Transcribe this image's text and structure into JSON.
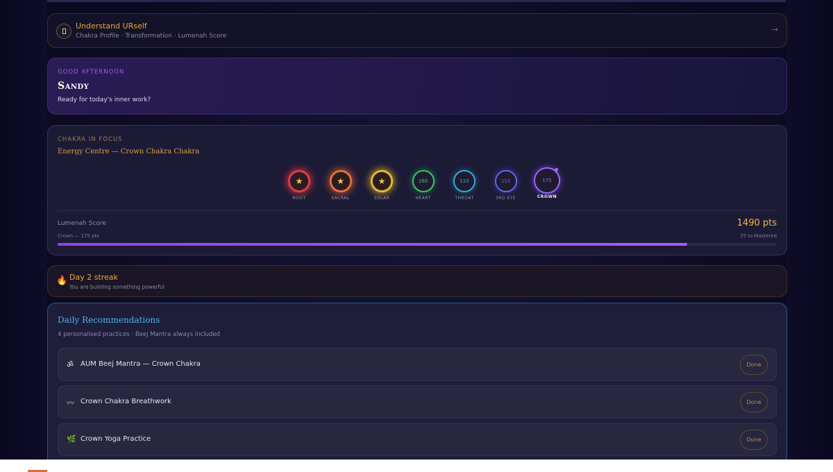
{
  "understand": {
    "title": "Understand URself",
    "subtitle": "Chakra Profile · Transformation · Lumenah Score",
    "arrow": "→"
  },
  "greeting": {
    "label": "GOOD AFTERNOON",
    "name": "Sandy",
    "subtitle": "Ready for today's inner work?"
  },
  "chakra": {
    "label": "CHAKRA IN FOCUS",
    "subtitle": "Energy Centre — Crown Chakra Chakra",
    "items": [
      {
        "name": "ROOT",
        "value": "★",
        "color": "#e0424f",
        "glow": "#c0303f",
        "mastered": true
      },
      {
        "name": "SACRAL",
        "value": "★",
        "color": "#e27d45",
        "glow": "#b9502e",
        "mastered": true
      },
      {
        "name": "SOLAR",
        "value": "★",
        "color": "#e8c43a",
        "glow": "#b89420",
        "mastered": true
      },
      {
        "name": "HEART",
        "value": "160",
        "color": "#3ec46e",
        "glow": "#1e6a3e",
        "mastered": false
      },
      {
        "name": "THROAT",
        "value": "110",
        "color": "#3fa8e0",
        "glow": "#1d5878",
        "mastered": false
      },
      {
        "name": "3RD EYE",
        "value": "110",
        "color": "#6668e6",
        "glow": "#333590",
        "mastered": false
      },
      {
        "name": "CROWN",
        "value": "175",
        "color": "#9a6bff",
        "glow": "#5a3aa8",
        "mastered": false
      }
    ],
    "lumenah_label": "Lumenah Score",
    "score": "1490 pts",
    "progress_left": "Crown — 175 pts",
    "progress_right": "25 to Mastered",
    "progress": 0.875
  },
  "streak": {
    "icon": "fire-icon",
    "title": "Day 2 streak",
    "subtitle": "You are building something powerful"
  },
  "daily": {
    "title": "Daily Recommendations",
    "subtitle": "4 personalised practices · Beej Mantra always included",
    "items": [
      {
        "icon": "ॐ",
        "label": "AUM Beej Mantra — Crown Chakra",
        "button": "Done"
      },
      {
        "icon": "〰",
        "label": "Crown Chakra Breathwork",
        "button": "Done"
      },
      {
        "icon": "🌿",
        "label": "Crown Yoga Practice",
        "button": "Done"
      }
    ]
  }
}
